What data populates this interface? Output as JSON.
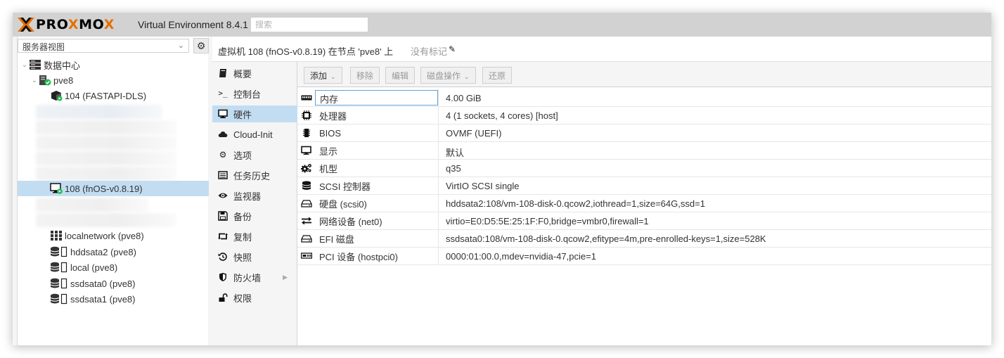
{
  "header": {
    "logo_prefix": "PRO",
    "logo_x": "X",
    "logo_mid": "MO",
    "logo_suffix": "X",
    "version": "Virtual Environment 8.4.1",
    "search_placeholder": "搜索"
  },
  "tree": {
    "view_label": "服务器视图",
    "datacenter": "数据中心",
    "node": "pve8",
    "items": [
      {
        "label": "104 (FASTAPI-DLS)",
        "type": "container"
      },
      {
        "label": "108 (fnOS-v0.8.19)",
        "type": "vm-running",
        "selected": true
      },
      {
        "label": "localnetwork (pve8)",
        "type": "network"
      },
      {
        "label": "hddsata2 (pve8)",
        "type": "storage"
      },
      {
        "label": "local (pve8)",
        "type": "storage"
      },
      {
        "label": "ssdsata0 (pve8)",
        "type": "storage"
      },
      {
        "label": "ssdsata1 (pve8)",
        "type": "storage"
      }
    ]
  },
  "content": {
    "title": "虚拟机 108 (fnOS-v0.8.19) 在节点 'pve8' 上",
    "no_tags": "没有标记"
  },
  "nav": {
    "items": [
      {
        "label": "概要",
        "icon": "book-icon"
      },
      {
        "label": "控制台",
        "icon": "terminal-icon"
      },
      {
        "label": "硬件",
        "icon": "desktop-icon",
        "selected": true
      },
      {
        "label": "Cloud-Init",
        "icon": "cloud-icon"
      },
      {
        "label": "选项",
        "icon": "gear-icon"
      },
      {
        "label": "任务历史",
        "icon": "list-icon"
      },
      {
        "label": "监视器",
        "icon": "eye-icon"
      },
      {
        "label": "备份",
        "icon": "floppy-icon"
      },
      {
        "label": "复制",
        "icon": "retweet-icon"
      },
      {
        "label": "快照",
        "icon": "history-icon"
      },
      {
        "label": "防火墙",
        "icon": "shield-icon"
      },
      {
        "label": "权限",
        "icon": "unlock-icon"
      }
    ]
  },
  "toolbar": {
    "add": "添加",
    "remove": "移除",
    "edit": "编辑",
    "disk_action": "磁盘操作",
    "revert": "还原"
  },
  "hardware": [
    {
      "name": "内存",
      "value": "4.00 GiB",
      "icon": "memory-icon"
    },
    {
      "name": "处理器",
      "value": "4 (1 sockets, 4 cores) [host]",
      "icon": "cpu-icon"
    },
    {
      "name": "BIOS",
      "value": "OVMF (UEFI)",
      "icon": "microchip-icon"
    },
    {
      "name": "显示",
      "value": "默认",
      "icon": "monitor-icon"
    },
    {
      "name": "机型",
      "value": "q35",
      "icon": "cogs-icon"
    },
    {
      "name": "SCSI 控制器",
      "value": "VirtIO SCSI single",
      "icon": "database-icon"
    },
    {
      "name": "硬盘 (scsi0)",
      "value": "hddsata2:108/vm-108-disk-0.qcow2,iothread=1,size=64G,ssd=1",
      "icon": "hdd-icon"
    },
    {
      "name": "网络设备 (net0)",
      "value": "virtio=E0:D5:5E:25:1F:F0,bridge=vmbr0,firewall=1",
      "icon": "exchange-icon"
    },
    {
      "name": "EFI 磁盘",
      "value": "ssdsata0:108/vm-108-disk-0.qcow2,efitype=4m,pre-enrolled-keys=1,size=528K",
      "icon": "hdd-icon"
    },
    {
      "name": "PCI 设备 (hostpci0)",
      "value": "0000:01:00.0,mdev=nvidia-47,pcie=1",
      "icon": "pci-card-icon"
    }
  ],
  "colors": {
    "accent_orange": "#e57000",
    "selection_blue": "#c2ddf2",
    "running_green": "#21bf4b"
  }
}
